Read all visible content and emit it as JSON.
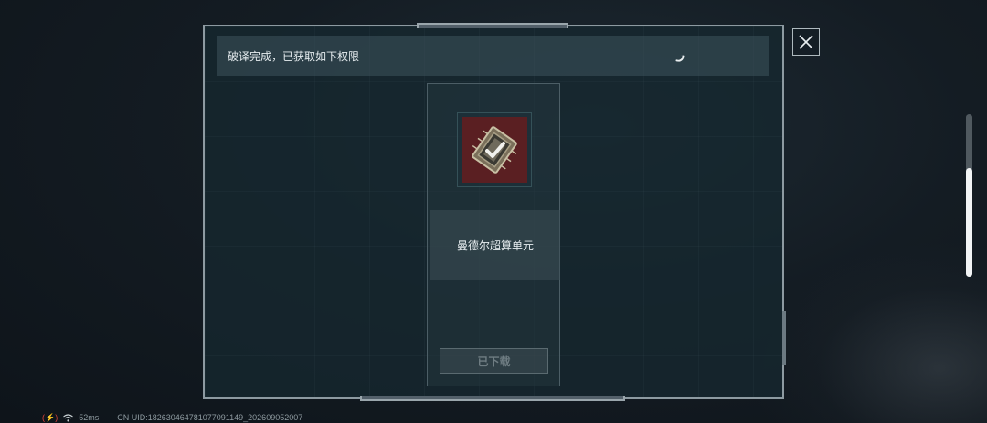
{
  "dialog": {
    "banner_text": "破译完成，已获取如下权限",
    "close_icon": "close-icon"
  },
  "reward": {
    "item_name": "曼德尔超算单元",
    "item_icon": "supercomputer-chip-icon",
    "button_label": "已下载"
  },
  "status_bar": {
    "battery_icon": "charging-bolt-icon",
    "bolt_text": "(⚡)",
    "wifi_icon": "wifi-icon",
    "latency": "52ms",
    "uid": "CN UID:182630464781077091149_202609052007"
  },
  "scrollbar": {
    "thumb_start": 0.33,
    "thumb_end": 1.0
  },
  "colors": {
    "panel_border": "#8d9aa1",
    "item_background": "#5a1f22",
    "charging": "#d8403b"
  }
}
